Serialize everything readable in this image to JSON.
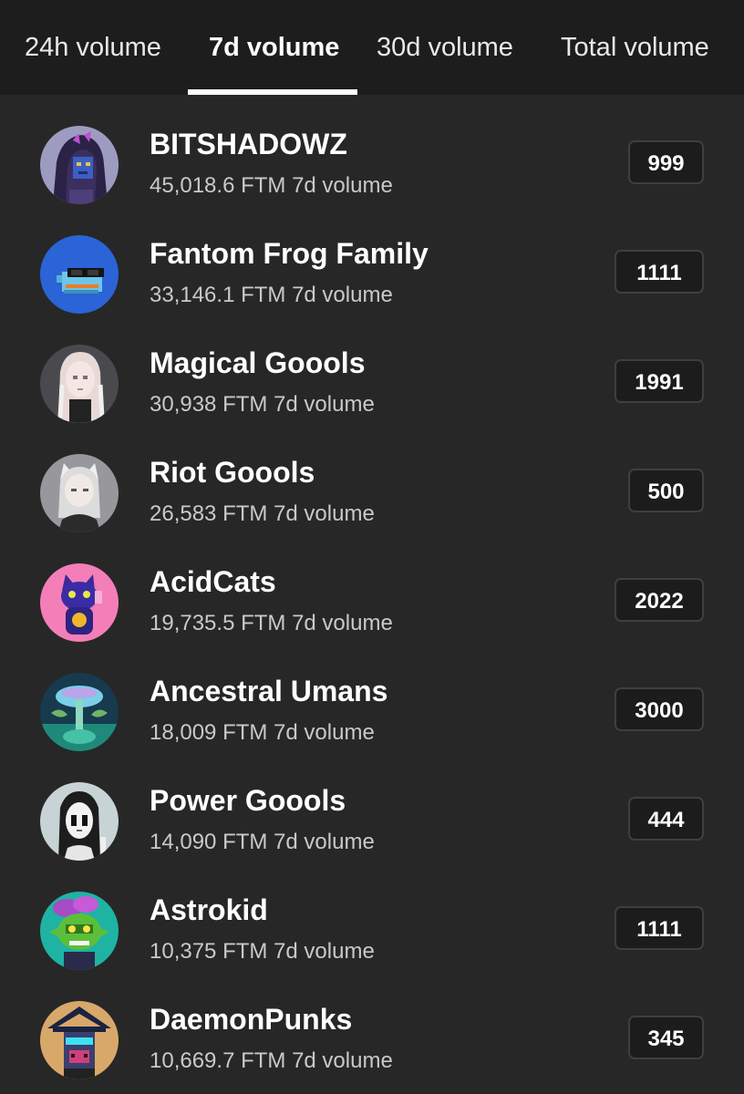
{
  "tabs": [
    {
      "label": "24h volume",
      "active": false
    },
    {
      "label": "7d volume",
      "active": true
    },
    {
      "label": "30d volume",
      "active": false
    },
    {
      "label": "Total volume",
      "active": false
    }
  ],
  "collections": [
    {
      "name": "BITSHADOWZ",
      "volume": "45,018.6 FTM 7d volume",
      "supply": "999",
      "avatar": "hooded-pixel-avatar"
    },
    {
      "name": "Fantom Frog Family",
      "volume": "33,146.1 FTM 7d volume",
      "supply": "1111",
      "avatar": "frog-sunglasses-avatar"
    },
    {
      "name": "Magical Goools",
      "volume": "30,938 FTM 7d volume",
      "supply": "1991",
      "avatar": "braided-girl-avatar"
    },
    {
      "name": "Riot Goools",
      "volume": "26,583 FTM 7d volume",
      "supply": "500",
      "avatar": "cat-ear-girl-avatar"
    },
    {
      "name": "AcidCats",
      "volume": "19,735.5 FTM 7d volume",
      "supply": "2022",
      "avatar": "lucky-cat-avatar"
    },
    {
      "name": "Ancestral Umans",
      "volume": "18,009 FTM 7d volume",
      "supply": "3000",
      "avatar": "mushroom-tree-avatar"
    },
    {
      "name": "Power Goools",
      "volume": "14,090 FTM 7d volume",
      "supply": "444",
      "avatar": "masked-figure-avatar"
    },
    {
      "name": "Astrokid",
      "volume": "10,375 FTM 7d volume",
      "supply": "1111",
      "avatar": "green-goblin-avatar"
    },
    {
      "name": "DaemonPunks",
      "volume": "10,669.7 FTM 7d volume",
      "supply": "345",
      "avatar": "pixel-punk-avatar"
    }
  ],
  "colors": {
    "background": "#272727",
    "tabbar": "#1d1d1d",
    "badge_border": "#3f3f3f",
    "secondary_text": "#c9c9c9"
  }
}
